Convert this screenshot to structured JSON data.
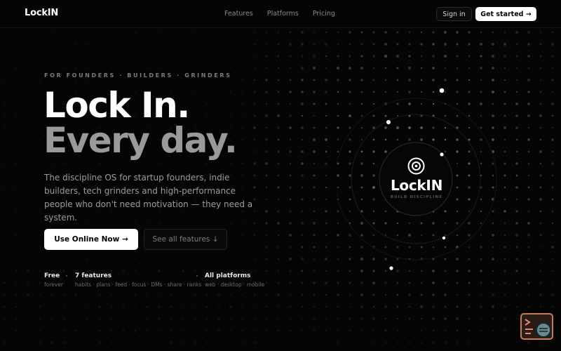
{
  "nav": {
    "brand": "LockIN",
    "links": [
      "Features",
      "Platforms",
      "Pricing"
    ],
    "signin": "Sign in",
    "get_started": "Get started →"
  },
  "hero": {
    "eyebrow": "FOR FOUNDERS · BUILDERS · GRINDERS",
    "headline_line1": "Lock In.",
    "headline_line2": "Every day.",
    "description": "The discipline OS for startup founders, indie builders, tech grinders and high-performance people who don't need motivation — they need a system.",
    "cta_primary": "Use Online Now →",
    "cta_secondary": "See all features ↓"
  },
  "stats": [
    {
      "label": "Free",
      "sub": "forever"
    },
    {
      "label": "7 features",
      "sub": "habits · plans · feed · focus · DMs · share · ranks"
    },
    {
      "label": "All platforms",
      "sub": "web · desktop · mobile"
    }
  ],
  "orb": {
    "title": "LockIN",
    "subtitle": "BUILD DISCIPLINE"
  },
  "colors": {
    "background": "#050505",
    "primary_button": "#ffffff",
    "muted_text": "#9b9b9b",
    "widget_border": "#c87a5a"
  },
  "icons": {
    "orb_icon": "target-icon",
    "widget_icon": "terminal-search-icon"
  }
}
